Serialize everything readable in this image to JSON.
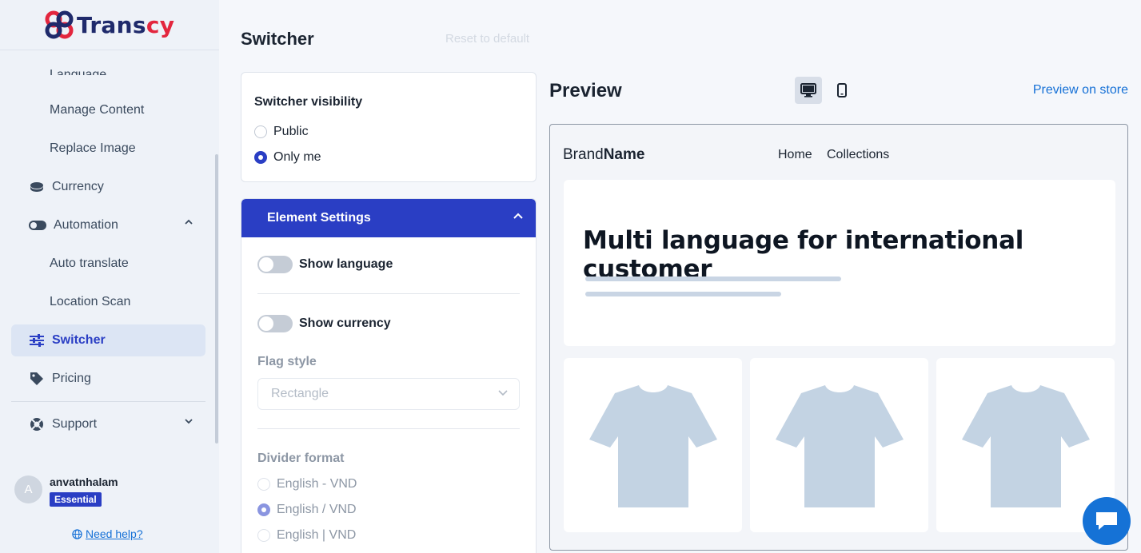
{
  "brand": {
    "logo_main": "Trans",
    "logo_accent": "cy"
  },
  "sidebar": {
    "items": [
      {
        "label": "Language",
        "level": "sub"
      },
      {
        "label": "Manage Content",
        "level": "sub"
      },
      {
        "label": "Replace Image",
        "level": "sub"
      },
      {
        "label": "Currency",
        "level": "top",
        "icon": "coins-icon"
      },
      {
        "label": "Automation",
        "level": "top",
        "icon": "toggle-icon"
      },
      {
        "label": "Auto translate",
        "level": "sub"
      },
      {
        "label": "Location Scan",
        "level": "sub"
      },
      {
        "label": "Switcher",
        "level": "top",
        "icon": "sliders-icon",
        "active": true
      },
      {
        "label": "Pricing",
        "level": "top",
        "icon": "tag-icon"
      },
      {
        "label": "Support",
        "level": "top",
        "icon": "lifebuoy-icon"
      }
    ],
    "user": {
      "avatar_initial": "A",
      "name": "anvatnhalam",
      "plan": "Essential"
    },
    "help_label": "Need help?"
  },
  "page": {
    "title": "Switcher",
    "reset_label": "Reset to default"
  },
  "visibility": {
    "label": "Switcher visibility",
    "options": [
      "Public",
      "Only me"
    ],
    "selected": "Only me"
  },
  "element_settings": {
    "header": "Element Settings",
    "show_language": {
      "label": "Show language",
      "on": false
    },
    "show_currency": {
      "label": "Show currency",
      "on": false
    },
    "flag_style": {
      "label": "Flag style",
      "value": "Rectangle"
    },
    "divider_format": {
      "label": "Divider format",
      "options": [
        "English - VND",
        "English / VND",
        "English | VND"
      ],
      "selected": "English / VND"
    }
  },
  "preview": {
    "title": "Preview",
    "store_link": "Preview on store",
    "device": "desktop",
    "brand_light": "Brand",
    "brand_bold": "Name",
    "nav": [
      "Home",
      "Collections"
    ],
    "hero_title": "Multi language for international customer"
  },
  "colors": {
    "primary": "#2a3ec4",
    "link": "#1570d6",
    "logo_dark": "#1f2a6b",
    "logo_accent": "#e3263e"
  }
}
